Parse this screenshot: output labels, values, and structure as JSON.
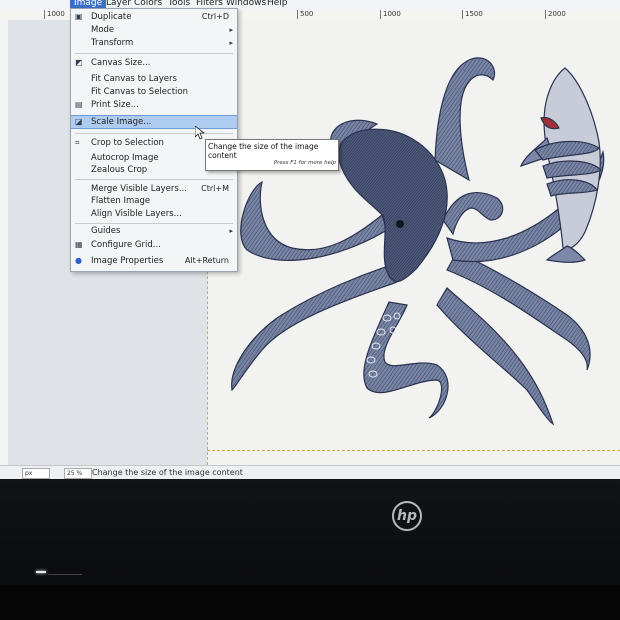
{
  "menubar": {
    "items": [
      "Image",
      "Layer",
      "Colors",
      "Tools",
      "Filters",
      "Windows",
      "Help"
    ]
  },
  "ruler": {
    "ticks": [
      "1000",
      "500",
      "1000",
      "1500",
      "2000"
    ]
  },
  "menu": {
    "items": [
      {
        "label": "Duplicate",
        "shortcut": "Ctrl+D",
        "icon": "duplicate-icon"
      },
      {
        "label": "Mode",
        "submenu": true
      },
      {
        "label": "Transform",
        "submenu": true
      },
      {
        "label": "Canvas Size...",
        "icon": "canvas-size-icon"
      },
      {
        "label": "Fit Canvas to Layers"
      },
      {
        "label": "Fit Canvas to Selection"
      },
      {
        "label": "Print Size...",
        "icon": "print-size-icon"
      },
      {
        "label": "Scale Image...",
        "icon": "scale-image-icon",
        "highlighted": true
      },
      {
        "label": "Crop to Selection",
        "icon": "crop-icon"
      },
      {
        "label": "Autocrop Image"
      },
      {
        "label": "Zealous Crop"
      },
      {
        "label": "Merge Visible Layers...",
        "shortcut": "Ctrl+M"
      },
      {
        "label": "Flatten Image"
      },
      {
        "label": "Align Visible Layers..."
      },
      {
        "label": "Guides",
        "submenu": true
      },
      {
        "label": "Configure Grid...",
        "icon": "grid-icon"
      },
      {
        "label": "Image Properties",
        "shortcut": "Alt+Return",
        "icon": "info-icon"
      }
    ]
  },
  "tooltip": {
    "text": "Change the size of the image content",
    "hint": "Press F1 for more help"
  },
  "statusbar": {
    "unit": "px",
    "zoom": "25 %",
    "message": "Change the size of the image content"
  },
  "laptop": {
    "brand": "hp"
  },
  "colors": {
    "menu_highlight": "#aecbf0",
    "menubar_active": "#3d6fc5",
    "ink": "#4a5576"
  }
}
